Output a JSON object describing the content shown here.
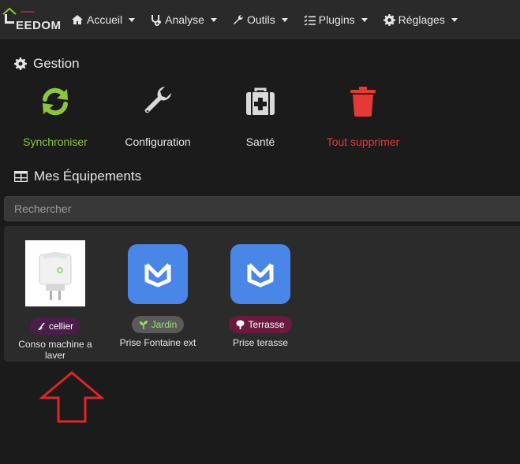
{
  "brand": {
    "text": "EEDOM"
  },
  "nav": [
    {
      "label": "Accueil",
      "icon": "home-icon"
    },
    {
      "label": "Analyse",
      "icon": "stethoscope-icon"
    },
    {
      "label": "Outils",
      "icon": "wrench-icon"
    },
    {
      "label": "Plugins",
      "icon": "list-check-icon"
    },
    {
      "label": "Réglages",
      "icon": "gear-icon"
    }
  ],
  "gestion": {
    "title": "Gestion",
    "buttons": [
      {
        "label": "Synchroniser",
        "color": "#8cc63f",
        "icon": "sync-icon"
      },
      {
        "label": "Configuration",
        "color": "#e6e6e6",
        "icon": "wrench-icon"
      },
      {
        "label": "Santé",
        "color": "#e6e6e6",
        "icon": "medkit-icon"
      },
      {
        "label": "Tout supprimer",
        "color": "#e53935",
        "icon": "trash-icon"
      }
    ]
  },
  "equipements": {
    "title": "Mes Équipements",
    "search_placeholder": "Rechercher",
    "items": [
      {
        "name": "Conso machine a laver",
        "badge": "cellier",
        "badge_color": "#4a1d4a",
        "badge_icon": "broom-icon",
        "image": "smart-plug-image"
      },
      {
        "name": "Prise Fontaine ext",
        "badge": "Jardin",
        "badge_color": "#5a5a5a",
        "badge_icon": "seedling-icon",
        "image": "meross-logo-icon"
      },
      {
        "name": "Prise terasse",
        "badge": "Terrasse",
        "badge_color": "#6a1a3f",
        "badge_icon": "tree-icon",
        "image": "meross-logo-icon"
      }
    ]
  },
  "colors": {
    "accent_green": "#8cc63f",
    "danger_red": "#e53935",
    "meross_blue": "#4a86e8"
  }
}
